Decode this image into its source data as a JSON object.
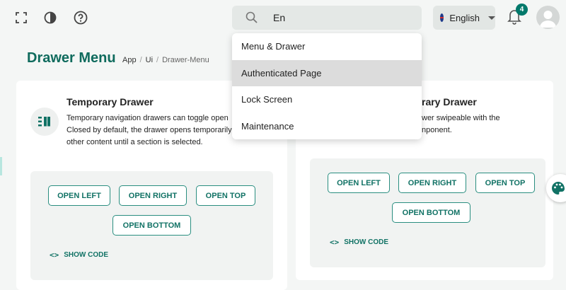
{
  "topbar": {
    "search": {
      "value": "En",
      "placeholder": ""
    },
    "language": "English",
    "notifications_count": "4",
    "icons": [
      "fullscreen-icon",
      "contrast-icon",
      "help-icon",
      "search-icon",
      "bell-icon",
      "avatar"
    ]
  },
  "search_dropdown": {
    "items": [
      "Menu & Drawer",
      "Authenticated Page",
      "Lock Screen",
      "Maintenance"
    ],
    "highlighted_index": 1
  },
  "page": {
    "title": "Drawer Menu",
    "breadcrumb": [
      "App",
      "Ui",
      "Drawer-Menu"
    ]
  },
  "cards": [
    {
      "title": "Temporary Drawer",
      "description": [
        "Temporary navigation drawers can toggle open",
        "Closed by default, the drawer opens temporarily",
        "other content until a section is selected."
      ],
      "buttons": [
        "OPEN LEFT",
        "OPEN RIGHT",
        "OPEN TOP",
        "OPEN BOTTOM"
      ],
      "show_code": "SHOW CODE"
    },
    {
      "title": "rary Drawer",
      "description": [
        "wer swipeable with the",
        "nponent."
      ],
      "buttons": [
        "OPEN LEFT",
        "OPEN RIGHT",
        "OPEN TOP",
        "OPEN BOTTOM"
      ],
      "show_code": "SHOW CODE"
    }
  ],
  "colors": {
    "accent": "#0f6b5d",
    "badge": "#00796b",
    "button_border": "#2a8e80"
  }
}
